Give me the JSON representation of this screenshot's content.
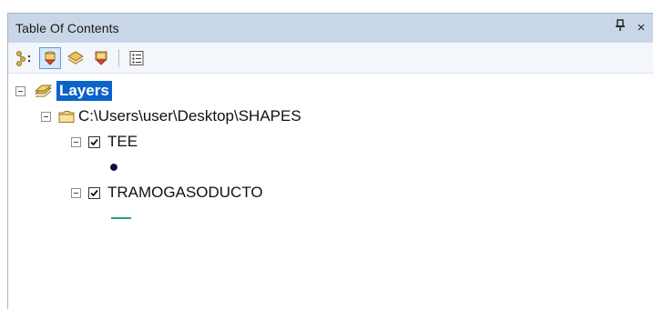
{
  "window": {
    "title": "Table Of Contents",
    "pin_glyph": "ѱ",
    "close_glyph": "×"
  },
  "toolbar": {
    "buttons": [
      {
        "name": "list-by-drawing-order-icon",
        "active": false
      },
      {
        "name": "list-by-source-icon",
        "active": true
      },
      {
        "name": "list-by-visibility-icon",
        "active": false
      },
      {
        "name": "list-by-selection-icon",
        "active": false
      },
      {
        "name": "options-icon",
        "active": false
      }
    ]
  },
  "tree": {
    "layers_label": "Layers",
    "folder_label": "C:\\Users\\user\\Desktop\\SHAPES",
    "layer1": {
      "label": "TEE",
      "checked": true,
      "symbol_color": "#0a0a5c"
    },
    "layer2": {
      "label": "TRAMOGASODUCTO",
      "checked": true,
      "symbol_color": "#1fa37a"
    }
  },
  "colors": {
    "selection": "#0c63c9",
    "titlebar": "#c9d6e8"
  }
}
